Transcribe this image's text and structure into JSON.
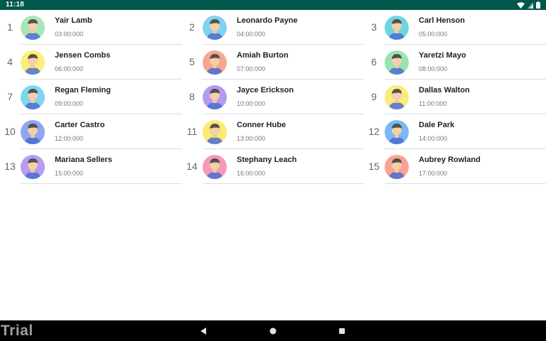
{
  "status_bar": {
    "time": "11:18",
    "icons": [
      "wifi-icon",
      "signal-icon",
      "battery-icon"
    ]
  },
  "colors": {
    "status_bar": "#00574b",
    "nav_bar": "#000000"
  },
  "contacts": [
    {
      "index": "1",
      "name": "Yair Lamb",
      "time": "03:00:000",
      "avatar_bg": "#a8e6b8",
      "avatar": "user-avatar-icon"
    },
    {
      "index": "2",
      "name": "Leonardo Payne",
      "time": "04:00:000",
      "avatar_bg": "#7ed3f0",
      "avatar": "user-avatar-icon"
    },
    {
      "index": "3",
      "name": "Carl Henson",
      "time": "05:00:000",
      "avatar_bg": "#6fd6e0",
      "avatar": "user-avatar-icon"
    },
    {
      "index": "4",
      "name": "Jensen Combs",
      "time": "06:00:000",
      "avatar_bg": "#fbef7a",
      "avatar": "user-avatar-icon"
    },
    {
      "index": "5",
      "name": "Amiah Burton",
      "time": "07:00:000",
      "avatar_bg": "#f7a78f",
      "avatar": "user-avatar-icon"
    },
    {
      "index": "6",
      "name": "Yaretzi Mayo",
      "time": "08:00:000",
      "avatar_bg": "#9de3b0",
      "avatar": "user-avatar-icon"
    },
    {
      "index": "7",
      "name": "Regan Fleming",
      "time": "09:00:000",
      "avatar_bg": "#7fd6f2",
      "avatar": "user-avatar-icon"
    },
    {
      "index": "8",
      "name": "Jayce Erickson",
      "time": "10:00:000",
      "avatar_bg": "#b59af0",
      "avatar": "user-avatar-icon"
    },
    {
      "index": "9",
      "name": "Dallas Walton",
      "time": "11:00:000",
      "avatar_bg": "#fbec7c",
      "avatar": "user-avatar-icon"
    },
    {
      "index": "10",
      "name": "Carter Castro",
      "time": "12:00:000",
      "avatar_bg": "#8fa6f2",
      "avatar": "user-avatar-icon"
    },
    {
      "index": "11",
      "name": "Conner Hube",
      "time": "13:00:000",
      "avatar_bg": "#fbea70",
      "avatar": "user-avatar-icon"
    },
    {
      "index": "12",
      "name": "Dale Park",
      "time": "14:00:000",
      "avatar_bg": "#7bb8f5",
      "avatar": "user-avatar-icon"
    },
    {
      "index": "13",
      "name": "Mariana Sellers",
      "time": "15:00:000",
      "avatar_bg": "#b79cf2",
      "avatar": "user-avatar-icon"
    },
    {
      "index": "14",
      "name": "Stephany Leach",
      "time": "16:00:000",
      "avatar_bg": "#f49ab8",
      "avatar": "user-avatar-icon"
    },
    {
      "index": "15",
      "name": "Aubrey Rowland",
      "time": "17:00:000",
      "avatar_bg": "#f8a394",
      "avatar": "user-avatar-icon"
    }
  ],
  "watermark": "Trial",
  "nav": {
    "back": "back-icon",
    "home": "home-icon",
    "recents": "recents-icon"
  }
}
